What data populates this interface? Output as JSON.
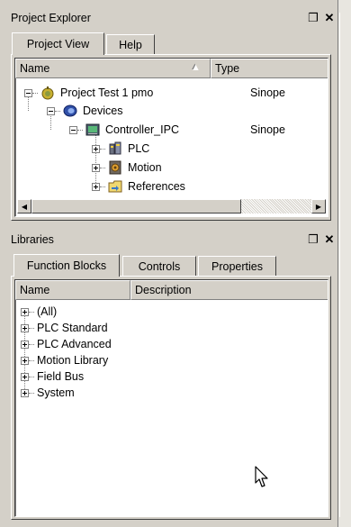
{
  "project_explorer": {
    "title": "Project Explorer",
    "tabs": [
      {
        "label": "Project View",
        "active": true
      },
      {
        "label": "Help",
        "active": false
      }
    ],
    "columns": {
      "name": "Name",
      "type": "Type"
    },
    "tree": [
      {
        "label": "Project Test 1 pmo",
        "type": "Sinope",
        "icon": "project-icon"
      },
      {
        "label": "Devices",
        "type": "",
        "icon": "devices-icon"
      },
      {
        "label": "Controller_IPC",
        "type": "Sinope",
        "icon": "controller-icon"
      },
      {
        "label": "PLC",
        "type": "",
        "icon": "plc-icon"
      },
      {
        "label": "Motion",
        "type": "",
        "icon": "motion-icon"
      },
      {
        "label": "References",
        "type": "",
        "icon": "references-icon"
      }
    ]
  },
  "libraries": {
    "title": "Libraries",
    "tabs": [
      {
        "label": "Function Blocks",
        "active": true
      },
      {
        "label": "Controls",
        "active": false
      },
      {
        "label": "Properties",
        "active": false
      }
    ],
    "columns": {
      "name": "Name",
      "description": "Description"
    },
    "items": [
      "(All)",
      "PLC Standard",
      "PLC Advanced",
      "Motion Library",
      "Field Bus",
      "System"
    ]
  },
  "colors": {
    "chrome": "#d4d0c8",
    "list_bg": "#ffffff",
    "shadow": "#808080"
  }
}
